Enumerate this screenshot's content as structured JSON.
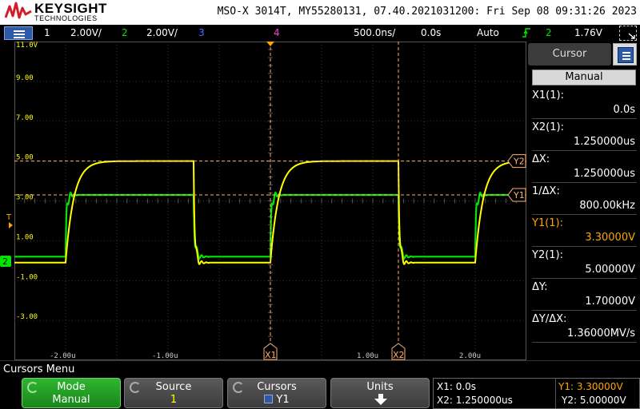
{
  "header": {
    "brand": "KEYSIGHT",
    "brand_sub": "TECHNOLOGIES",
    "device_info": "MSO-X 3014T, MY55280131, 07.40.2021031200: Fri Sep 08 09:31:26 2023"
  },
  "status": {
    "ch1_num": "1",
    "ch1_scale": "2.00V/",
    "ch2_num": "2",
    "ch2_scale": "2.00V/",
    "ch3_num": "3",
    "ch4_num": "4",
    "timebase": "500.0ns/",
    "delay": "0.0s",
    "trigger_mode": "Auto",
    "trigger_source": "2",
    "trigger_level": "1.76V"
  },
  "graticule": {
    "y_labels": [
      "11.0V",
      "9.00",
      "7.00",
      "5.00",
      "3.00",
      "1.00",
      "-1.00",
      "-3.00"
    ],
    "x_labels": [
      "-2.00u",
      "-1.00u",
      "1.00u",
      "2.00u"
    ],
    "cursor_markers": {
      "x1": "X1",
      "x2": "X2",
      "y1": "Y1",
      "y2": "Y2"
    },
    "ground_marker": "2",
    "trigger_marker": "T"
  },
  "panel": {
    "title": "Cursor",
    "mode": "Manual",
    "rows": [
      {
        "label": "X1(1):",
        "value": "0.0s"
      },
      {
        "label": "X2(1):",
        "value": "1.250000us"
      },
      {
        "label": "ΔX:",
        "value": "1.250000us"
      },
      {
        "label": "1/ΔX:",
        "value": "800.00kHz"
      },
      {
        "label": "Y1(1):",
        "value": "3.30000V"
      },
      {
        "label": "Y2(1):",
        "value": "5.00000V"
      },
      {
        "label": "ΔY:",
        "value": "1.70000V"
      },
      {
        "label": "ΔY/ΔX:",
        "value": "1.36000MV/s"
      }
    ]
  },
  "menu": {
    "title": "Cursors Menu",
    "softkeys": {
      "mode_label": "Mode",
      "mode_value": "Manual",
      "source_label": "Source",
      "source_value": "1",
      "cursors_label": "Cursors",
      "cursors_value": "Y1",
      "units_label": "Units"
    },
    "readout": {
      "x1": "X1: 0.0s",
      "x2": "X2: 1.250000us",
      "y1": "Y1: 3.30000V",
      "y2": "Y2: 5.00000V"
    }
  },
  "colors": {
    "ch1": "#ffff00",
    "ch2": "#00e600",
    "ch3": "#4d6bff",
    "ch4": "#ff3ed6",
    "cursor": "#ffb070",
    "accent": "#ffa500"
  },
  "icons": {
    "menu": "menu-lines-icon",
    "trigger": "trigger-edge-icon",
    "zoom": "zoom-box-icon",
    "up": "up-arrow-icon",
    "units": "down-arrow-icon",
    "knob": "knob-icon",
    "logo": "keysight-wave-icon"
  }
}
